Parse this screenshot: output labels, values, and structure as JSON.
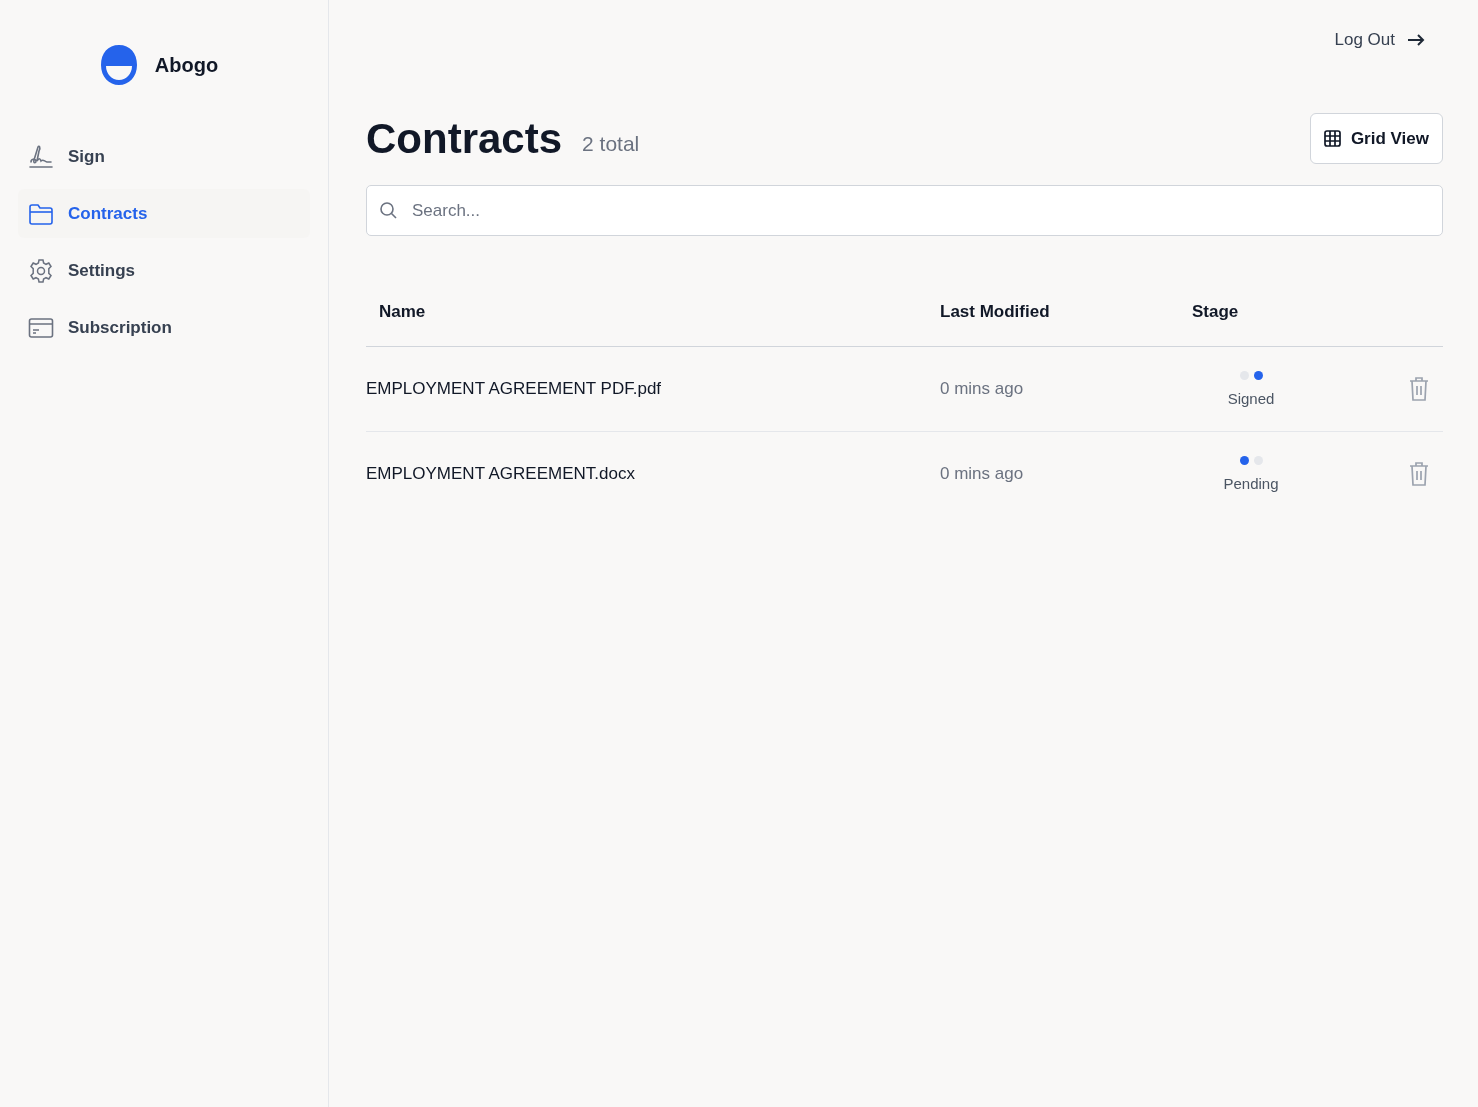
{
  "brand": {
    "name": "Abogo"
  },
  "sidebar": {
    "items": [
      {
        "label": "Sign",
        "kind": "sign",
        "selected": false
      },
      {
        "label": "Contracts",
        "kind": "folder",
        "selected": true
      },
      {
        "label": "Settings",
        "kind": "gear",
        "selected": false
      },
      {
        "label": "Subscription",
        "kind": "card",
        "selected": false
      }
    ]
  },
  "header": {
    "logout": "Log Out",
    "title": "Contracts",
    "count": "2 total",
    "view_button": "Grid View"
  },
  "search": {
    "placeholder": "Search..."
  },
  "table": {
    "columns": [
      "Name",
      "Last Modified",
      "Stage"
    ],
    "rows": [
      {
        "name": "EMPLOYMENT AGREEMENT PDF.pdf",
        "modified": "0 mins ago",
        "stage": "Signed",
        "dots": [
          {
            "on": false
          },
          {
            "on": true
          }
        ]
      },
      {
        "name": "EMPLOYMENT AGREEMENT.docx",
        "modified": "0 mins ago",
        "stage": "Pending",
        "dots": [
          {
            "on": true
          },
          {
            "on": false
          }
        ]
      }
    ]
  }
}
